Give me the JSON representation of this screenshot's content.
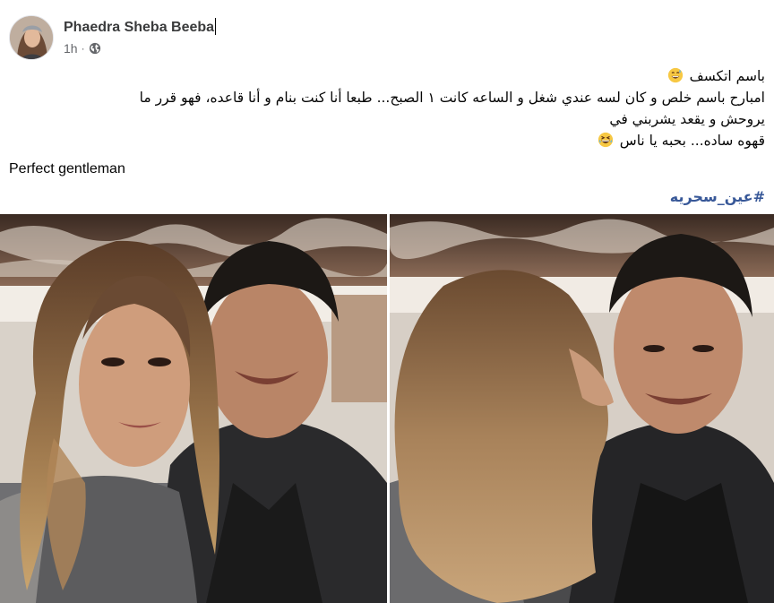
{
  "post": {
    "author": "Phaedra Sheba Beeba",
    "time": "1h",
    "separator": "·",
    "privacy_icon": "globe-icon",
    "lines": [
      "باسم اتكسف",
      "امبارح باسم خلص و كان لسه عندي شغل و الساعه كانت ١ الصبح... طبعا أنا كنت بنام و أنا قاعده، فهو قرر ما",
      "يروحش و يقعد يشربني في",
      "قهوه ساده... بحبه يا ناس"
    ],
    "english_line": "Perfect gentleman",
    "hashtag": "#عين_سحريه",
    "emoji_icons": [
      "grinning-sweat-emoji",
      "laughing-emoji"
    ]
  },
  "photos": [
    {
      "icon": "selfie-photo-icon"
    },
    {
      "icon": "kiss-photo-icon"
    }
  ],
  "colors": {
    "author": "#3a3b3c",
    "meta": "#65676b",
    "hashtag": "#385898",
    "text": "#050505"
  }
}
